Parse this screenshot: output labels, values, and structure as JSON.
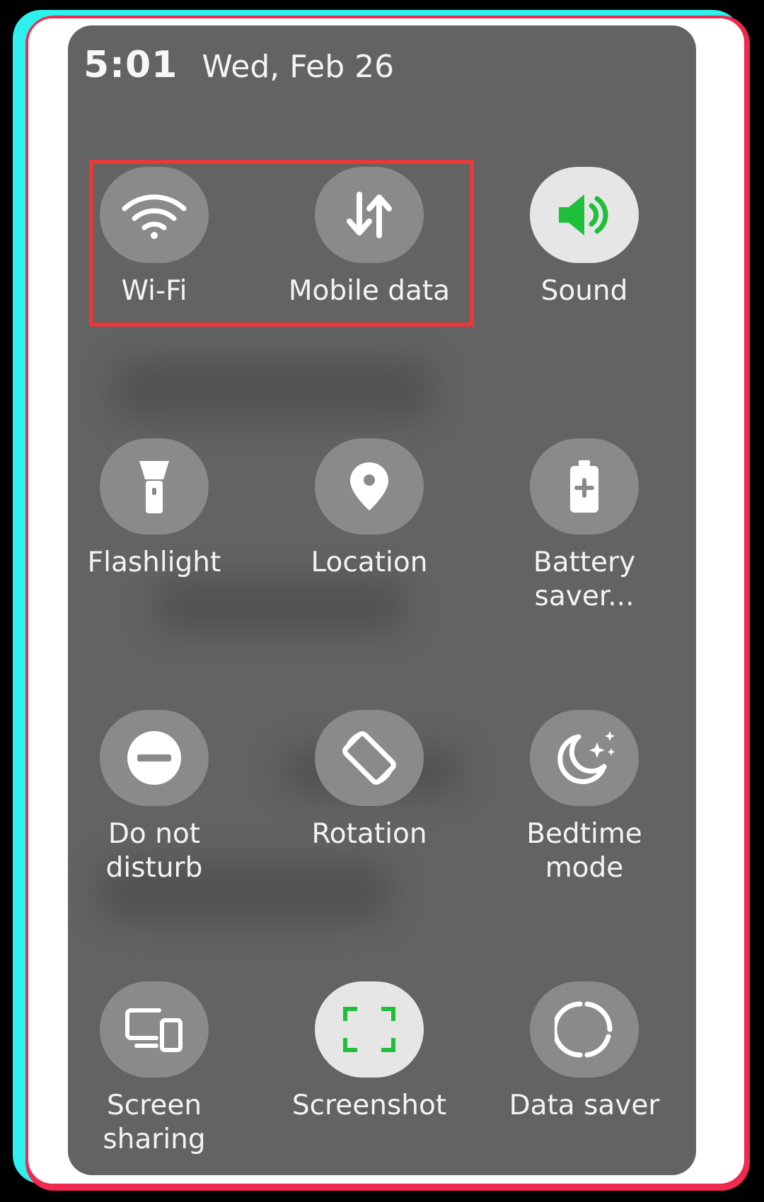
{
  "status": {
    "time": "5:01",
    "date": "Wed, Feb 26"
  },
  "tiles": [
    {
      "id": "wifi",
      "label_lines": [
        "Wi-Fi"
      ],
      "icon": "wifi-icon",
      "active": false
    },
    {
      "id": "mobile-data",
      "label_lines": [
        "Mobile data"
      ],
      "icon": "arrows-up-down-icon",
      "active": false
    },
    {
      "id": "sound",
      "label_lines": [
        "Sound"
      ],
      "icon": "speaker-icon",
      "active": true
    },
    {
      "id": "flashlight",
      "label_lines": [
        "Flashlight"
      ],
      "icon": "flashlight-icon",
      "active": false
    },
    {
      "id": "location",
      "label_lines": [
        "Location"
      ],
      "icon": "location-pin-icon",
      "active": false
    },
    {
      "id": "battery-saver",
      "label_lines": [
        "Battery",
        "saver..."
      ],
      "icon": "battery-plus-icon",
      "active": false
    },
    {
      "id": "do-not-disturb",
      "label_lines": [
        "Do not",
        "disturb"
      ],
      "icon": "minus-circle-icon",
      "active": false
    },
    {
      "id": "rotation",
      "label_lines": [
        "Rotation"
      ],
      "icon": "rotate-icon",
      "active": false
    },
    {
      "id": "bedtime-mode",
      "label_lines": [
        "Bedtime",
        "mode"
      ],
      "icon": "moon-stars-icon",
      "active": false
    },
    {
      "id": "screen-sharing",
      "label_lines": [
        "Screen",
        "sharing"
      ],
      "icon": "screen-devices-icon",
      "active": false
    },
    {
      "id": "screenshot",
      "label_lines": [
        "Screenshot"
      ],
      "icon": "screenshot-frame-icon",
      "active": true
    },
    {
      "id": "data-saver",
      "label_lines": [
        "Data saver"
      ],
      "icon": "data-saver-ring-icon",
      "active": false
    }
  ],
  "colors": {
    "panel": "#636363",
    "tile_off": "#8a8a8a",
    "tile_on": "#e6e6e6",
    "accent_green": "#1fbf3a",
    "highlight_box": "#e63939",
    "frame_cyan": "#2ef0ec",
    "frame_red": "#f02a4e"
  }
}
